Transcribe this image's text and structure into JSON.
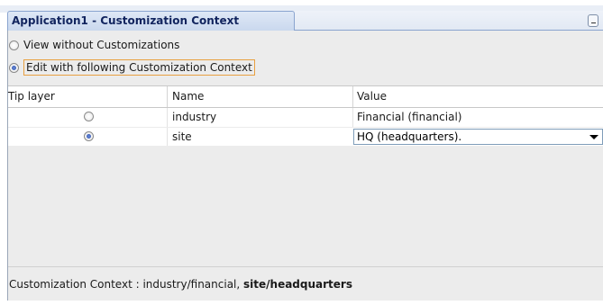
{
  "window": {
    "title": "Application1 - Customization Context"
  },
  "options": {
    "view_without": {
      "label": "View without Customizations",
      "selected": false
    },
    "edit_with": {
      "label": "Edit with following Customization Context",
      "selected": true
    }
  },
  "table": {
    "headers": {
      "tip_layer": "Tip layer",
      "name": "Name",
      "value": "Value"
    },
    "rows": [
      {
        "tip_selected": false,
        "name": "industry",
        "value": "Financial (financial)"
      },
      {
        "tip_selected": true,
        "name": "site",
        "value": "HQ (headquarters)."
      }
    ]
  },
  "status": {
    "prefix": "Customization Context : industry/financial, ",
    "bold": "site/headquarters"
  },
  "icons": {
    "minimize": "minimize-icon",
    "dropdown": "chevron-down-icon"
  }
}
